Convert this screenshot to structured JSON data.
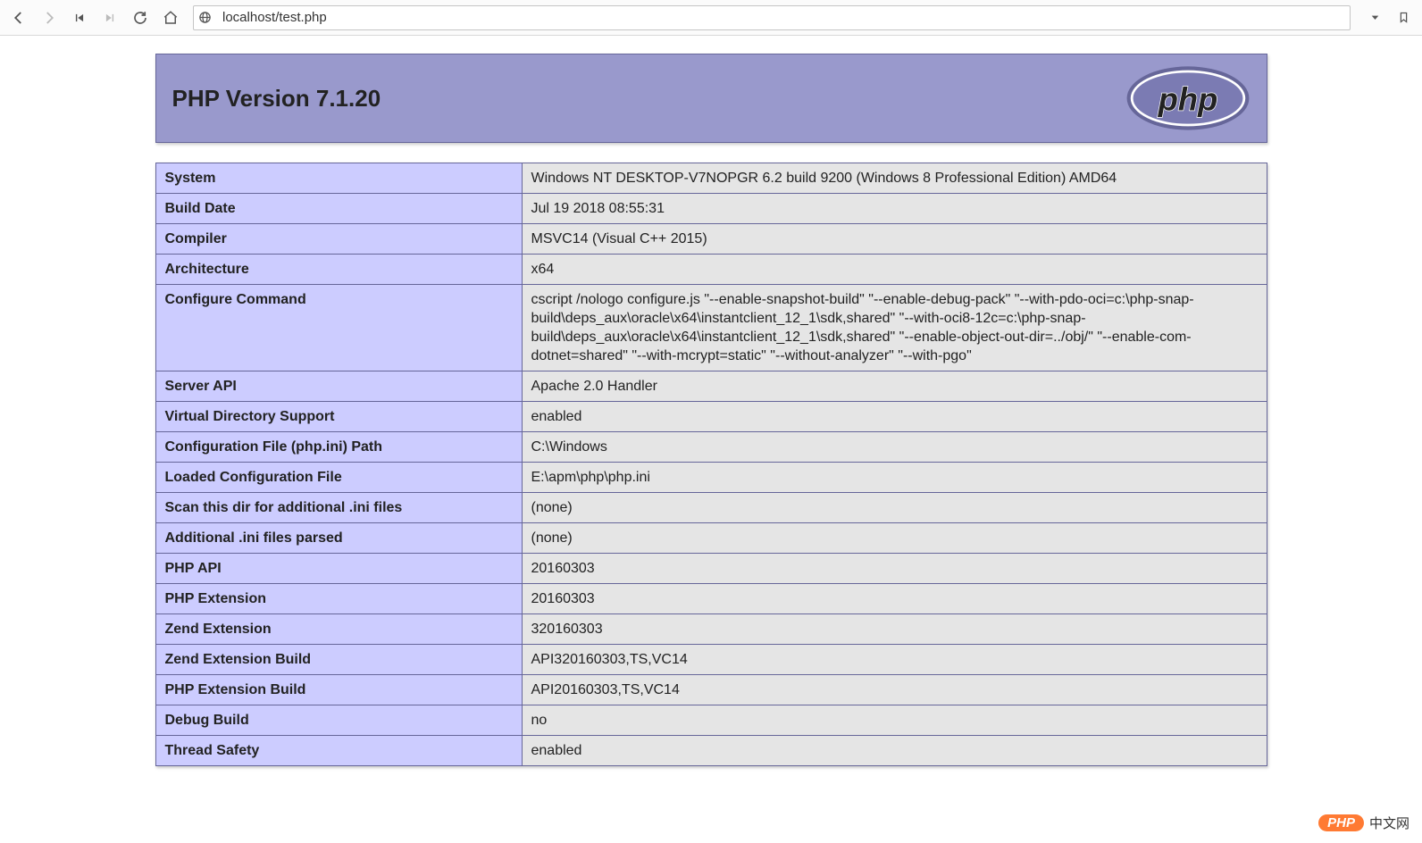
{
  "browser": {
    "url": "localhost/test.php"
  },
  "header": {
    "title": "PHP Version 7.1.20",
    "logo_text": "php"
  },
  "rows": [
    {
      "label": "System",
      "value": "Windows NT DESKTOP-V7NOPGR 6.2 build 9200 (Windows 8 Professional Edition) AMD64"
    },
    {
      "label": "Build Date",
      "value": "Jul 19 2018 08:55:31"
    },
    {
      "label": "Compiler",
      "value": "MSVC14 (Visual C++ 2015)"
    },
    {
      "label": "Architecture",
      "value": "x64"
    },
    {
      "label": "Configure Command",
      "value": "cscript /nologo configure.js \"--enable-snapshot-build\" \"--enable-debug-pack\" \"--with-pdo-oci=c:\\php-snap-build\\deps_aux\\oracle\\x64\\instantclient_12_1\\sdk,shared\" \"--with-oci8-12c=c:\\php-snap-build\\deps_aux\\oracle\\x64\\instantclient_12_1\\sdk,shared\" \"--enable-object-out-dir=../obj/\" \"--enable-com-dotnet=shared\" \"--with-mcrypt=static\" \"--without-analyzer\" \"--with-pgo\""
    },
    {
      "label": "Server API",
      "value": "Apache 2.0 Handler"
    },
    {
      "label": "Virtual Directory Support",
      "value": "enabled"
    },
    {
      "label": "Configuration File (php.ini) Path",
      "value": "C:\\Windows"
    },
    {
      "label": "Loaded Configuration File",
      "value": "E:\\apm\\php\\php.ini"
    },
    {
      "label": "Scan this dir for additional .ini files",
      "value": "(none)"
    },
    {
      "label": "Additional .ini files parsed",
      "value": "(none)"
    },
    {
      "label": "PHP API",
      "value": "20160303"
    },
    {
      "label": "PHP Extension",
      "value": "20160303"
    },
    {
      "label": "Zend Extension",
      "value": "320160303"
    },
    {
      "label": "Zend Extension Build",
      "value": "API320160303,TS,VC14"
    },
    {
      "label": "PHP Extension Build",
      "value": "API20160303,TS,VC14"
    },
    {
      "label": "Debug Build",
      "value": "no"
    },
    {
      "label": "Thread Safety",
      "value": "enabled"
    }
  ],
  "watermark": {
    "pill": "PHP",
    "text": "中文网"
  }
}
